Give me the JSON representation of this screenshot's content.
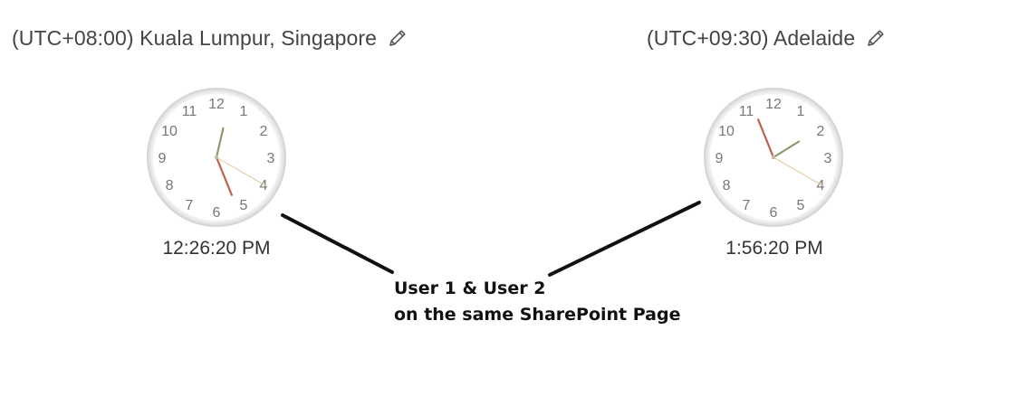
{
  "clocks": [
    {
      "timezone_label": "(UTC+08:00) Kuala Lumpur, Singapore",
      "time_display": "12:26:20 PM",
      "time": {
        "hours": 12,
        "minutes": 26,
        "seconds": 20
      },
      "edit_icon": "pencil-icon"
    },
    {
      "timezone_label": "(UTC+09:30) Adelaide",
      "time_display": "1:56:20 PM",
      "time": {
        "hours": 1,
        "minutes": 56,
        "seconds": 20
      },
      "edit_icon": "pencil-icon"
    }
  ],
  "dial_numbers": [
    "12",
    "1",
    "2",
    "3",
    "4",
    "5",
    "6",
    "7",
    "8",
    "9",
    "10",
    "11"
  ],
  "colors": {
    "hour_hand": "#8b9a6b",
    "minute_hand": "#c0604e",
    "second_hand": "#e6c9a4",
    "dial_number": "#777777",
    "clock_face": "#ffffff",
    "clock_rim": "#e2e2e2"
  },
  "annotation": {
    "line1": "User 1 & User 2",
    "line2": "on the same SharePoint Page"
  }
}
